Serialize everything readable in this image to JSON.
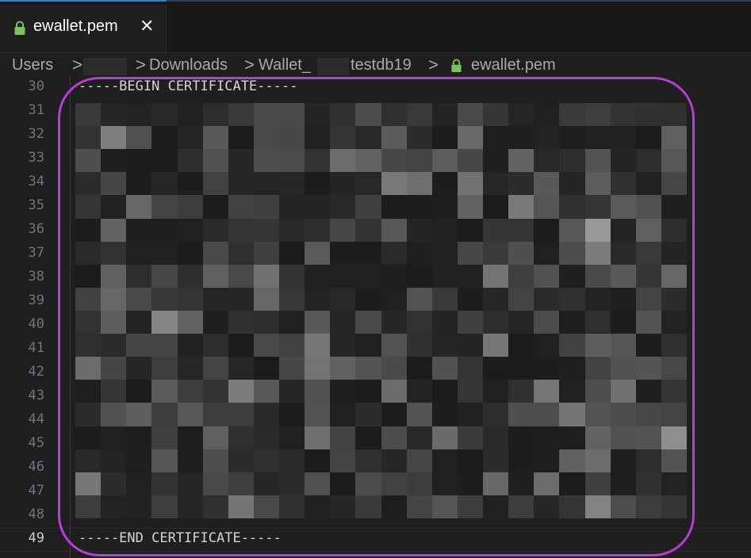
{
  "tab": {
    "label": "ewallet.pem",
    "close": "✕",
    "icon": "lock-icon",
    "icon_color": "#7dc35b"
  },
  "breadcrumb": {
    "items": [
      "Users",
      "Downloads",
      "Wallet_",
      "testdb19",
      "ewallet.pem"
    ],
    "separator": ">"
  },
  "editor": {
    "lines": [
      {
        "num": "30",
        "text": "-----BEGIN CERTIFICATE-----"
      },
      {
        "num": "31",
        "text": ""
      },
      {
        "num": "32",
        "text": ""
      },
      {
        "num": "33",
        "text": ""
      },
      {
        "num": "34",
        "text": ""
      },
      {
        "num": "35",
        "text": ""
      },
      {
        "num": "36",
        "text": ""
      },
      {
        "num": "37",
        "text": ""
      },
      {
        "num": "38",
        "text": ""
      },
      {
        "num": "39",
        "text": ""
      },
      {
        "num": "40",
        "text": ""
      },
      {
        "num": "41",
        "text": ""
      },
      {
        "num": "42",
        "text": ""
      },
      {
        "num": "43",
        "text": ""
      },
      {
        "num": "44",
        "text": ""
      },
      {
        "num": "45",
        "text": ""
      },
      {
        "num": "46",
        "text": ""
      },
      {
        "num": "47",
        "text": ""
      },
      {
        "num": "48",
        "text": ""
      },
      {
        "num": "49",
        "text": "-----END CERTIFICATE-----"
      }
    ],
    "active_line": "49",
    "redacted": true
  },
  "colors": {
    "highlight": "#b63ed1",
    "accent": "#2a80d8",
    "background": "#1f1f1f"
  }
}
